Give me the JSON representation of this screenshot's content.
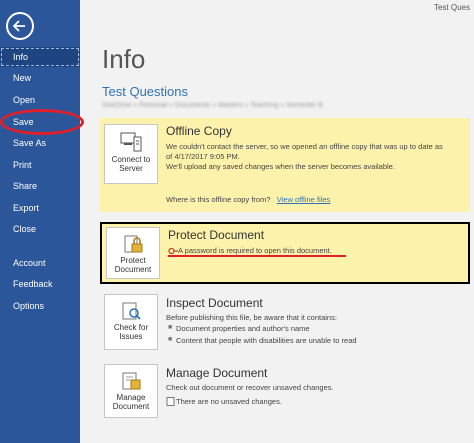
{
  "window": {
    "user": "Test Ques"
  },
  "sidebar": {
    "items": [
      {
        "label": "Info"
      },
      {
        "label": "New"
      },
      {
        "label": "Open"
      },
      {
        "label": "Save"
      },
      {
        "label": "Save As"
      },
      {
        "label": "Print"
      },
      {
        "label": "Share"
      },
      {
        "label": "Export"
      },
      {
        "label": "Close"
      },
      {
        "label": "Account"
      },
      {
        "label": "Feedback"
      },
      {
        "label": "Options"
      }
    ]
  },
  "main": {
    "title": "Info",
    "doc_title": "Test Questions",
    "doc_path": "OneDrive » Personal » Documents » Masters » Teaching » Semester B",
    "offline": {
      "button_line1": "Connect to",
      "button_line2": "Server",
      "title": "Offline Copy",
      "text1": "We couldn't contact the server, so we opened an offline copy that was up to date as",
      "text2": "of 4/17/2017 9:05 PM.",
      "text3": "We'll upload any saved changes when the server becomes available.",
      "question": "Where is this offline copy from?",
      "link": "View offline files"
    },
    "protect": {
      "button_line1": "Protect",
      "button_line2": "Document",
      "title": "Protect Document",
      "text": "A password is required to open this document."
    },
    "inspect": {
      "button_line1": "Check for",
      "button_line2": "Issues",
      "title": "Inspect Document",
      "text": "Before publishing this file, be aware that it contains:",
      "bullet1": "Document properties and author's name",
      "bullet2": "Content that people with disabilities are unable to read"
    },
    "manage": {
      "button_line1": "Manage",
      "button_line2": "Document",
      "title": "Manage Document",
      "text": "Check out document or recover unsaved changes.",
      "status": "There are no unsaved changes."
    }
  }
}
